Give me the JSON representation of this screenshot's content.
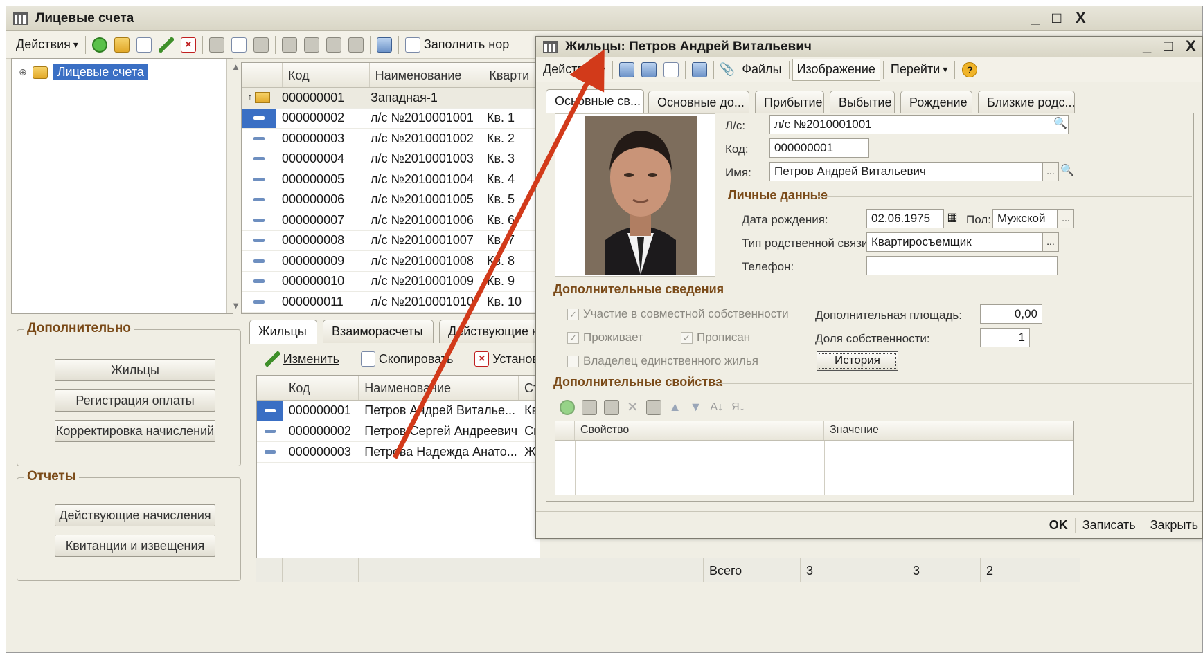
{
  "main": {
    "title": "Лицевые счета",
    "window_controls": [
      "_",
      "□",
      "X"
    ],
    "toolbar": {
      "actions_label": "Действия",
      "fill_label": "Заполнить нор"
    },
    "tree": {
      "root_label": "Лицевые счета",
      "expand_glyph": "⊕"
    },
    "grid": {
      "columns": [
        "Код",
        "Наименование",
        "Кварти"
      ],
      "rows": [
        {
          "code": "000000001",
          "name": "Западная-1",
          "apt": ""
        },
        {
          "code": "000000002",
          "name": "л/с №2010001001",
          "apt": "Кв. 1"
        },
        {
          "code": "000000003",
          "name": "л/с №2010001002",
          "apt": "Кв. 2"
        },
        {
          "code": "000000004",
          "name": "л/с №2010001003",
          "apt": "Кв. 3"
        },
        {
          "code": "000000005",
          "name": "л/с №2010001004",
          "apt": "Кв. 4"
        },
        {
          "code": "000000006",
          "name": "л/с №2010001005",
          "apt": "Кв. 5"
        },
        {
          "code": "000000007",
          "name": "л/с №2010001006",
          "apt": "Кв. 6"
        },
        {
          "code": "000000008",
          "name": "л/с №2010001007",
          "apt": "Кв. 7"
        },
        {
          "code": "000000009",
          "name": "л/с №2010001008",
          "apt": "Кв. 8"
        },
        {
          "code": "000000010",
          "name": "л/с №2010001009",
          "apt": "Кв. 9"
        },
        {
          "code": "000000011",
          "name": "л/с №2010001010",
          "apt": "Кв. 10"
        }
      ]
    },
    "additional": {
      "title": "Дополнительно",
      "buttons": [
        "Жильцы",
        "Регистрация оплаты",
        "Корректировка начислений"
      ]
    },
    "reports": {
      "title": "Отчеты",
      "buttons": [
        "Действующие начисления",
        "Квитанции и извещения"
      ]
    },
    "tabs": [
      "Жильцы",
      "Взаиморасчеты",
      "Действующие н"
    ],
    "sub_toolbar": {
      "edit": "Изменить",
      "copy": "Скопировать",
      "set": "Установ"
    },
    "residents": {
      "columns": [
        "Код",
        "Наименование",
        "Ст"
      ],
      "rows": [
        {
          "code": "000000001",
          "name": "Петров Андрей Виталье...",
          "st": "Кв"
        },
        {
          "code": "000000002",
          "name": "Петров Сергей Андреевич",
          "st": "Сы"
        },
        {
          "code": "000000003",
          "name": "Петрова Надежда Анато...",
          "st": "Жі"
        }
      ]
    },
    "status": {
      "total_label": "Всего",
      "v1": "3",
      "v2": "3",
      "v3": "2"
    }
  },
  "dialog": {
    "title": "Жильцы: Петров Андрей Витальевич",
    "toolbar": {
      "actions": "Действия",
      "files": "Файлы",
      "image": "Изображение",
      "goto": "Перейти"
    },
    "tabs": [
      "Основные св...",
      "Основные до...",
      "Прибытие",
      "Выбытие",
      "Рождение",
      "Близкие родс..."
    ],
    "fields": {
      "ls_label": "Л/с:",
      "ls_value": "л/с №2010001001",
      "code_label": "Код:",
      "code_value": "000000001",
      "name_label": "Имя:",
      "name_value": "Петров Андрей Витальевич"
    },
    "personal": {
      "title": "Личные данные",
      "dob_label": "Дата рождения:",
      "dob_value": "02.06.1975",
      "sex_label": "Пол:",
      "sex_value": "Мужской",
      "rel_label": "Тип родственной связи:",
      "rel_value": "Квартиросъемщик",
      "phone_label": "Телефон:",
      "phone_value": ""
    },
    "extra": {
      "title": "Дополнительные сведения",
      "shared_ownership": "Участие в совместной собственности",
      "lives": "Проживает",
      "registered": "Прописан",
      "sole_owner": "Владелец единственного жилья",
      "area_label": "Дополнительная площадь:",
      "area_value": "0,00",
      "share_label": "Доля собственности:",
      "share_value": "1",
      "history_btn": "История"
    },
    "props": {
      "title": "Дополнительные свойства",
      "columns": [
        "Свойство",
        "Значение"
      ]
    },
    "footer": {
      "ok": "OK",
      "save": "Записать",
      "close": "Закрыть"
    }
  },
  "colors": {
    "accent": "#3a6fc4",
    "section": "#7a4a18",
    "arrow": "#d23a1a"
  }
}
